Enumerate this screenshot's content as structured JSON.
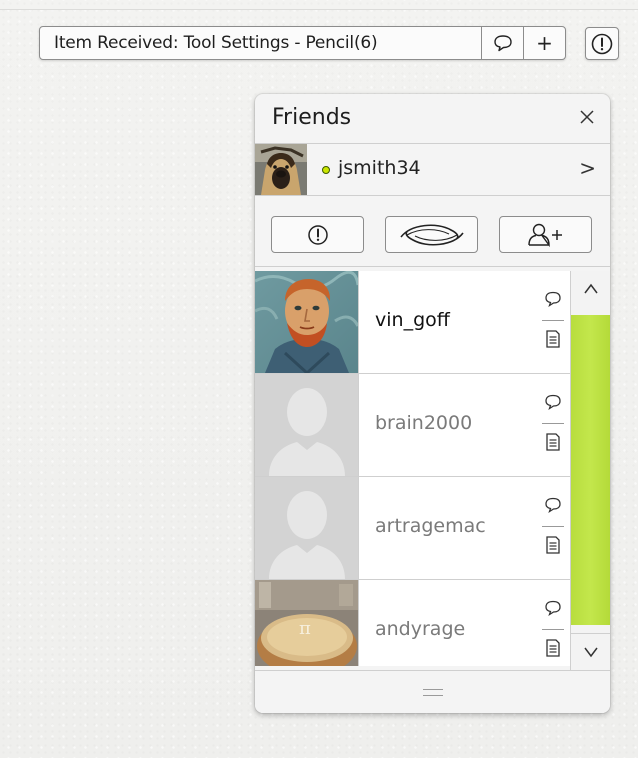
{
  "notification": {
    "text": "Item Received: Tool Settings - Pencil(6)",
    "chat_icon": "chat-bubble-icon",
    "add_label": "+",
    "alert_icon": "alert-circle-icon"
  },
  "panel": {
    "title": "Friends",
    "close_label": "×",
    "me": {
      "username": "jsmith34",
      "status": "online",
      "status_color": "#cbe600",
      "chevron": ">"
    },
    "tools": {
      "alert_icon": "alert-circle-icon",
      "sync_icon": "sync-swirl-icon",
      "add_friend_icon": "add-friend-icon"
    },
    "friends": [
      {
        "name": "vin_goff",
        "online": true,
        "avatar": "van-gogh-portrait"
      },
      {
        "name": "brain2000",
        "online": false,
        "avatar": "default-silhouette"
      },
      {
        "name": "artragemac",
        "online": false,
        "avatar": "default-silhouette"
      },
      {
        "name": "andyrage",
        "online": false,
        "avatar": "pie-photo"
      }
    ],
    "scrollbar": {
      "up_label": "^",
      "down_label": "v",
      "thumb_color": "#c1e546"
    }
  },
  "colors": {
    "accent": "#c1e546",
    "background": "#f1f1ef",
    "panel": "#f4f4f4"
  }
}
